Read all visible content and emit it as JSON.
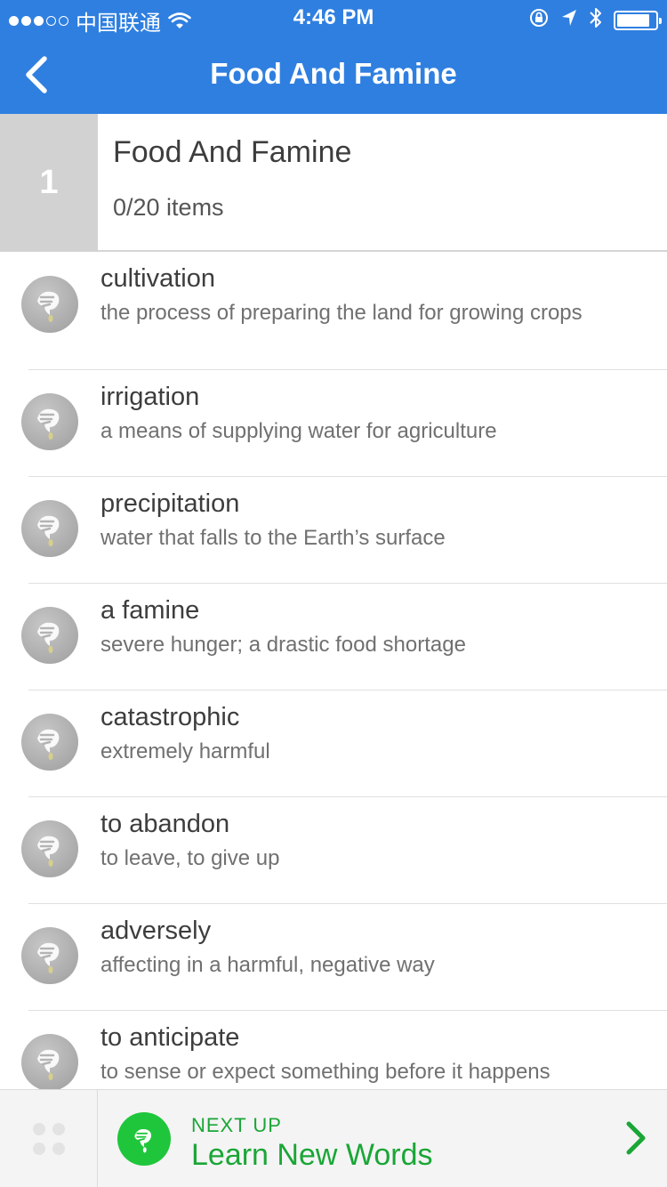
{
  "status_bar": {
    "carrier": "中国联通",
    "time": "4:46 PM",
    "battery_level": 0.85,
    "signal_bars_filled": 3,
    "signal_bars_total": 5
  },
  "nav": {
    "title": "Food And Famine"
  },
  "level": {
    "number": "1",
    "title": "Food And Famine",
    "progress": "0/20 items"
  },
  "words": [
    {
      "term": "cultivation",
      "definition": "the process of preparing the land for growing crops"
    },
    {
      "term": "irrigation",
      "definition": "a means of supplying water for agriculture"
    },
    {
      "term": "precipitation",
      "definition": "water that falls to the Earth’s surface"
    },
    {
      "term": "a famine",
      "definition": "severe hunger; a drastic food shortage"
    },
    {
      "term": "catastrophic",
      "definition": "extremely harmful"
    },
    {
      "term": "to abandon",
      "definition": "to leave, to give up"
    },
    {
      "term": "adversely",
      "definition": "affecting in a harmful, negative way"
    },
    {
      "term": "to anticipate",
      "definition": "to sense or expect something before it happens"
    }
  ],
  "bottom_bar": {
    "next_up_label": "NEXT UP",
    "next_up_title": "Learn New Words"
  },
  "colors": {
    "header_blue": "#2f7fe0",
    "accent_green": "#1fc63b",
    "text_green": "#1aa636"
  },
  "icons": {
    "back": "chevron-left-icon",
    "word_status": "plant-icon",
    "grid": "grid-dots-icon",
    "next": "chevron-right-icon"
  }
}
